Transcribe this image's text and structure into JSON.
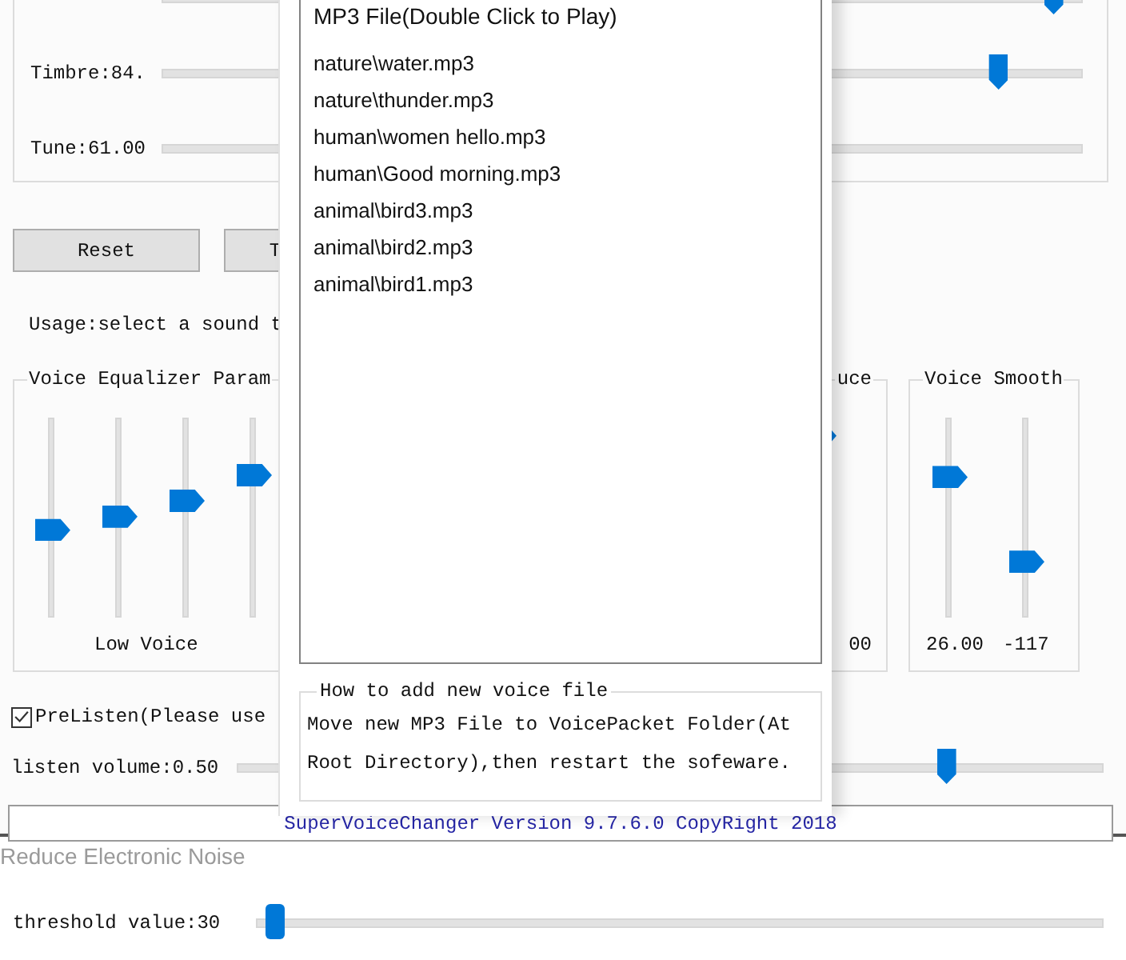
{
  "tone_panel": {
    "sliders": [
      {
        "level": 0.97
      },
      {
        "label": "Timbre:84.",
        "level": 0.91
      },
      {
        "label": "Tune:61.00"
      }
    ]
  },
  "buttons": [
    {
      "label": "Reset"
    },
    {
      "label": "T"
    }
  ],
  "usage": "Usage:select a sound t",
  "groups": [
    {
      "kind": "equalizer",
      "title": "Voice Equalizer Param",
      "sliders": [
        {
          "level": 0.46
        },
        {
          "level": 0.53
        },
        {
          "level": 0.61
        },
        {
          "level": 0.74
        }
      ],
      "caption": "Low Voice"
    },
    {
      "kind": "partial",
      "title": "uce",
      "sliders": [
        {
          "level": 0.94
        }
      ],
      "values": [
        "00"
      ]
    },
    {
      "kind": "smooth",
      "title": "Voice Smooth",
      "sliders": [
        {
          "level": 0.73
        },
        {
          "level": 0.3
        }
      ],
      "values": [
        "26.00",
        "-117"
      ]
    }
  ],
  "prelisten": {
    "label": "PreListen(Please use",
    "checked": true
  },
  "listen_volume": {
    "label": "listen volume:0.50",
    "level": 0.82
  },
  "status_bar": "SuperVoiceChanger Version 9.7.6.0 CopyRight 2018",
  "noise": {
    "title": "Reduce Electronic Noise",
    "threshold": {
      "label": "threshold value:30",
      "level": 0.02
    }
  },
  "popup": {
    "list_header": "MP3 File(Double Click to Play)",
    "files": [
      "nature\\water.mp3",
      "nature\\thunder.mp3",
      "human\\women hello.mp3",
      "human\\Good morning.mp3",
      "animal\\bird3.mp3",
      "animal\\bird2.mp3",
      "animal\\bird1.mp3"
    ],
    "help": {
      "title": "How to add new voice file",
      "text": "Move new MP3 File to VoicePacket Folder(At Root Directory),then restart the sofeware."
    }
  }
}
